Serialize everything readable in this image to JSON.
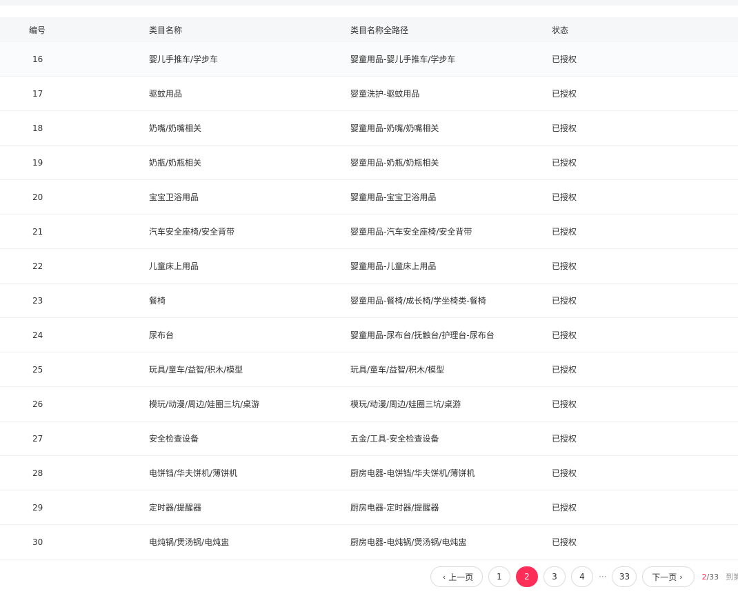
{
  "columns": {
    "id": "编号",
    "name": "类目名称",
    "path": "类目名称全路径",
    "status": "状态"
  },
  "rows": [
    {
      "id": "16",
      "name": "婴儿手推车/学步车",
      "path": "婴童用品-婴儿手推车/学步车",
      "status": "已授权"
    },
    {
      "id": "17",
      "name": "驱蚊用品",
      "path": "婴童洗护-驱蚊用品",
      "status": "已授权"
    },
    {
      "id": "18",
      "name": "奶嘴/奶嘴相关",
      "path": "婴童用品-奶嘴/奶嘴相关",
      "status": "已授权"
    },
    {
      "id": "19",
      "name": "奶瓶/奶瓶相关",
      "path": "婴童用品-奶瓶/奶瓶相关",
      "status": "已授权"
    },
    {
      "id": "20",
      "name": "宝宝卫浴用品",
      "path": "婴童用品-宝宝卫浴用品",
      "status": "已授权"
    },
    {
      "id": "21",
      "name": "汽车安全座椅/安全背带",
      "path": "婴童用品-汽车安全座椅/安全背带",
      "status": "已授权"
    },
    {
      "id": "22",
      "name": "儿童床上用品",
      "path": "婴童用品-儿童床上用品",
      "status": "已授权"
    },
    {
      "id": "23",
      "name": "餐椅",
      "path": "婴童用品-餐椅/成长椅/学坐椅类-餐椅",
      "status": "已授权"
    },
    {
      "id": "24",
      "name": "尿布台",
      "path": "婴童用品-尿布台/抚触台/护理台-尿布台",
      "status": "已授权"
    },
    {
      "id": "25",
      "name": "玩具/童车/益智/积木/模型",
      "path": "玩具/童车/益智/积木/模型",
      "status": "已授权"
    },
    {
      "id": "26",
      "name": "模玩/动漫/周边/娃圈三坑/桌游",
      "path": "模玩/动漫/周边/娃圈三坑/桌游",
      "status": "已授权"
    },
    {
      "id": "27",
      "name": "安全检查设备",
      "path": "五金/工具-安全检查设备",
      "status": "已授权"
    },
    {
      "id": "28",
      "name": "电饼铛/华夫饼机/薄饼机",
      "path": "厨房电器-电饼铛/华夫饼机/薄饼机",
      "status": "已授权"
    },
    {
      "id": "29",
      "name": "定时器/提醒器",
      "path": "厨房电器-定时器/提醒器",
      "status": "已授权"
    },
    {
      "id": "30",
      "name": "电炖锅/煲汤锅/电炖盅",
      "path": "厨房电器-电炖锅/煲汤锅/电炖盅",
      "status": "已授权"
    }
  ],
  "pagination": {
    "prev_label": "上一页",
    "next_label": "下一页",
    "pages": [
      "1",
      "2",
      "3",
      "4"
    ],
    "current": "2",
    "ellipsis": "···",
    "last": "33",
    "info_current": "2",
    "info_total": "/33",
    "goto_label": "到第"
  },
  "colors": {
    "accent": "#ff2e59",
    "header_bg": "#f6f7f9",
    "border": "#dcdcdc"
  }
}
